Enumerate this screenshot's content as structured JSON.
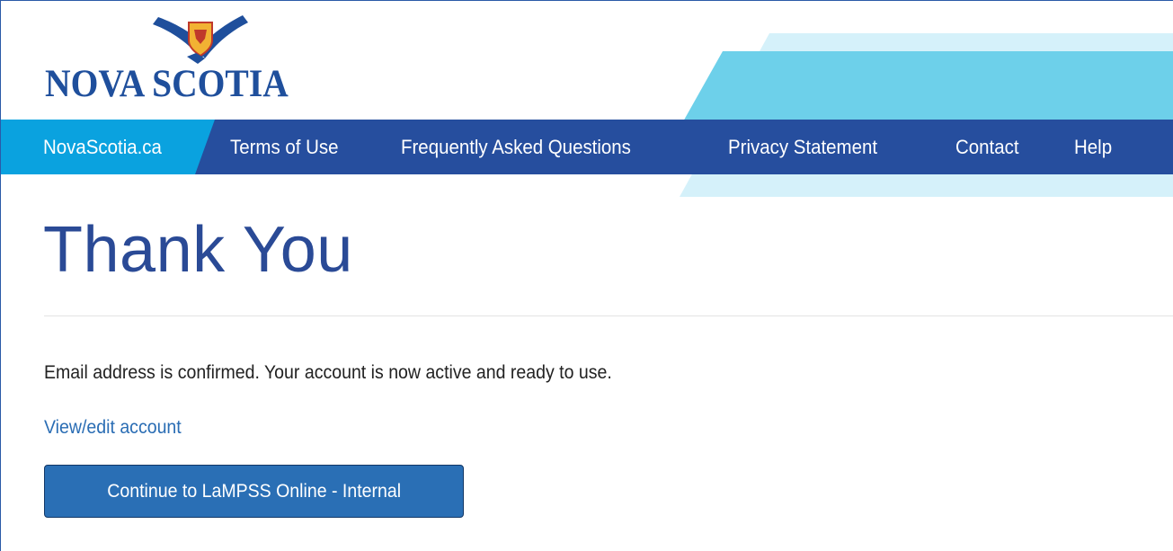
{
  "brand": {
    "logo_text": "NOVA SCOTIA",
    "colors": {
      "navy": "#264e9e",
      "cyan": "#0aa2df",
      "light_cyan": "#6dd0ea",
      "pale_cyan": "#d5f1fa",
      "title_blue": "#2a4a96",
      "link_blue": "#2a6db4",
      "button_blue": "#2a6fb5"
    }
  },
  "nav": {
    "items": [
      {
        "label": "NovaScotia.ca"
      },
      {
        "label": "Terms of Use"
      },
      {
        "label": "Frequently Asked Questions"
      },
      {
        "label": "Privacy Statement"
      },
      {
        "label": "Contact"
      },
      {
        "label": "Help"
      }
    ]
  },
  "main": {
    "title": "Thank You",
    "message": "Email address is confirmed. Your account is now active and ready to use.",
    "edit_link": "View/edit account",
    "continue_button": "Continue to LaMPSS Online - Internal"
  }
}
